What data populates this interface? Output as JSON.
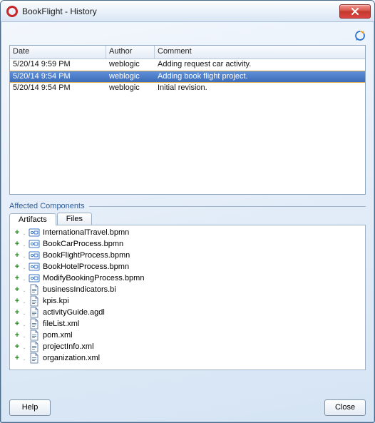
{
  "window": {
    "title": "BookFlight - History"
  },
  "icons": {
    "app": "oracle-logo-icon",
    "close": "close-icon",
    "refresh": "refresh-icon",
    "plus": "+",
    "dot": "."
  },
  "history": {
    "columns": {
      "date": "Date",
      "author": "Author",
      "comment": "Comment"
    },
    "rows": [
      {
        "date": "5/20/14 9:59 PM",
        "author": "weblogic",
        "comment": "Adding request car activity.",
        "selected": false
      },
      {
        "date": "5/20/14 9:54 PM",
        "author": "weblogic",
        "comment": "Adding book flight project.",
        "selected": true
      },
      {
        "date": "5/20/14 9:54 PM",
        "author": "weblogic",
        "comment": "Initial revision.",
        "selected": false
      }
    ]
  },
  "affected": {
    "group_label": "Affected Components",
    "tabs": {
      "artifacts": "Artifacts",
      "files": "Files",
      "active": "artifacts"
    },
    "items": [
      {
        "name": "InternationalTravel.bpmn",
        "icon": "bpmn"
      },
      {
        "name": "BookCarProcess.bpmn",
        "icon": "bpmn"
      },
      {
        "name": "BookFlightProcess.bpmn",
        "icon": "bpmn"
      },
      {
        "name": "BookHotelProcess.bpmn",
        "icon": "bpmn"
      },
      {
        "name": "ModifyBookingProcess.bpmn",
        "icon": "bpmn"
      },
      {
        "name": "businessIndicators.bi",
        "icon": "generic"
      },
      {
        "name": "kpis.kpi",
        "icon": "generic"
      },
      {
        "name": "activityGuide.agdl",
        "icon": "generic"
      },
      {
        "name": "fileList.xml",
        "icon": "generic"
      },
      {
        "name": "pom.xml",
        "icon": "generic"
      },
      {
        "name": "projectInfo.xml",
        "icon": "generic"
      },
      {
        "name": "organization.xml",
        "icon": "generic"
      }
    ]
  },
  "footer": {
    "help": "Help",
    "close": "Close"
  }
}
